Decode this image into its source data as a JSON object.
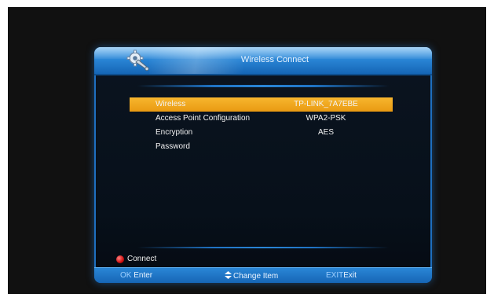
{
  "window": {
    "title": "Wireless Connect",
    "icon": "settings-wrench-gear-icon"
  },
  "settings": [
    {
      "label": "Wireless",
      "value": "TP-LINK_7A7EBE",
      "selected": true
    },
    {
      "label": "Access Point Configuration",
      "value": "WPA2-PSK",
      "selected": false
    },
    {
      "label": "Encryption",
      "value": "AES",
      "selected": false
    },
    {
      "label": "Password",
      "value": "",
      "selected": false
    }
  ],
  "connect": {
    "label": "Connect",
    "icon": "red-button-icon"
  },
  "footer": {
    "ok_key": "OK",
    "ok_label": "Enter",
    "change_label": "Change Item",
    "change_icon": "up-down-arrows-icon",
    "exit_key": "EXIT",
    "exit_label": "Exit"
  },
  "colors": {
    "highlight": "#f0a81e",
    "title_bar": "#2a86d6",
    "background": "#111111",
    "connect_button": "#d01010"
  }
}
